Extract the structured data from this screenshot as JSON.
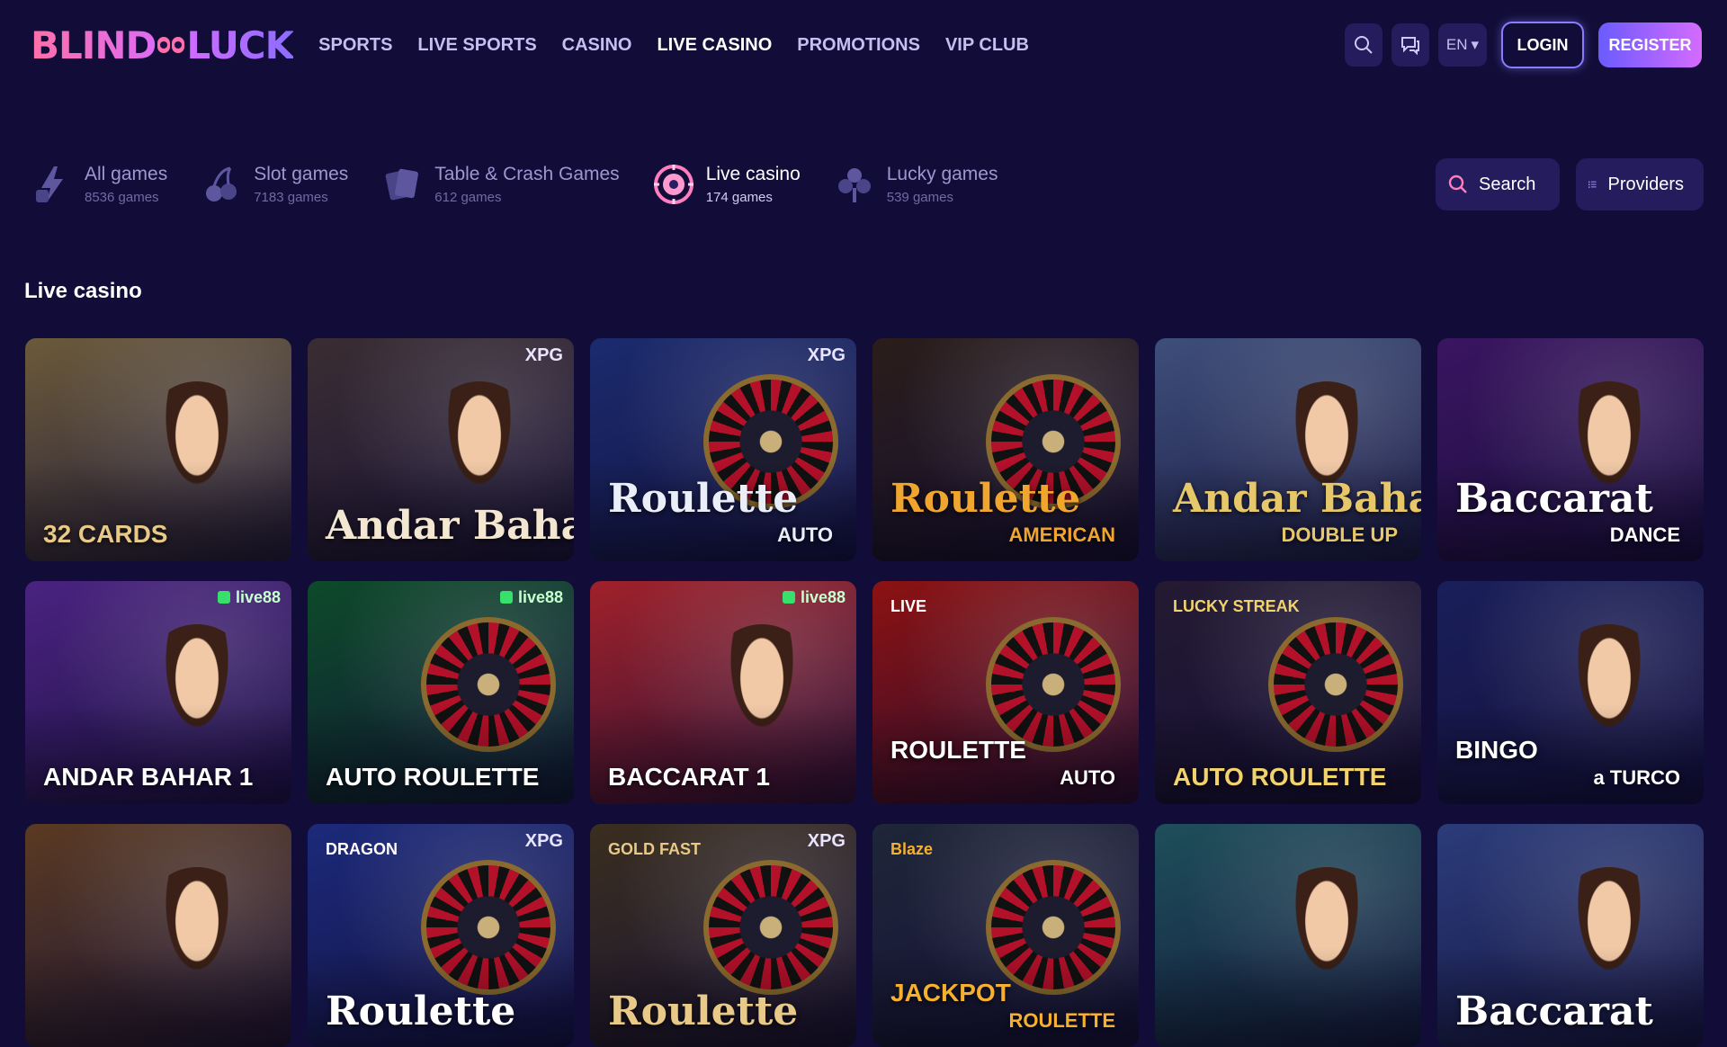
{
  "header": {
    "logo_text_left": "BLIND",
    "logo_text_right": "LUCK",
    "nav": [
      {
        "label": "SPORTS",
        "active": false
      },
      {
        "label": "LIVE SPORTS",
        "active": false
      },
      {
        "label": "CASINO",
        "active": false
      },
      {
        "label": "LIVE CASINO",
        "active": true
      },
      {
        "label": "PROMOTIONS",
        "active": false
      },
      {
        "label": "VIP CLUB",
        "active": false
      }
    ],
    "search_icon": "search-icon",
    "chat_icon": "chat-icon",
    "language": "EN",
    "login_label": "LOGIN",
    "register_label": "REGISTER"
  },
  "categories": [
    {
      "title": "All games",
      "count": "8536 games",
      "icon": "lightning-icon",
      "active": false
    },
    {
      "title": "Slot games",
      "count": "7183 games",
      "icon": "cherries-icon",
      "active": false
    },
    {
      "title": "Table & Crash Games",
      "count": "612 games",
      "icon": "cards-icon",
      "active": false
    },
    {
      "title": "Live casino",
      "count": "174 games",
      "icon": "roulette-chip-icon",
      "active": true
    },
    {
      "title": "Lucky games",
      "count": "539 games",
      "icon": "clover-icon",
      "active": false
    }
  ],
  "tools": {
    "search_label": "Search",
    "providers_label": "Providers"
  },
  "section_title": "Live casino",
  "games": [
    {
      "title": "32 CARDS",
      "brand": "",
      "bg": "#6b5a3a",
      "accent": "#e8c987"
    },
    {
      "title": "Andar Bahar",
      "brand": "XPG",
      "bg": "#3a2d32",
      "accent": "#f3e7d2"
    },
    {
      "title": "Roulette",
      "subtitle": "AUTO",
      "brand": "XPG",
      "bg": "#1b2b6e",
      "accent": "#e9eef9"
    },
    {
      "title": "Roulette",
      "subtitle": "AMERICAN",
      "brand": "",
      "bg": "#2a1d1a",
      "accent": "#f0a52e"
    },
    {
      "title": "Andar Bahar",
      "subtitle": "DOUBLE UP",
      "brand": "",
      "bg": "#3e4f7a",
      "accent": "#e6c76a"
    },
    {
      "title": "Baccarat",
      "subtitle": "DANCE",
      "brand": "",
      "bg": "#3a1560",
      "accent": "#ffffff"
    },
    {
      "title": "ANDAR BAHAR 1",
      "brand": "live88",
      "bg": "#4a2380",
      "accent": "#ffffff"
    },
    {
      "title": "AUTO ROULETTE",
      "brand": "live88",
      "bg": "#0d4a2a",
      "accent": "#ffffff"
    },
    {
      "title": "BACCARAT 1",
      "brand": "live88",
      "bg": "#a0212a",
      "accent": "#ffffff"
    },
    {
      "title": "ROULETTE",
      "pretitle": "LIVE",
      "subtitle": "AUTO",
      "brand": "",
      "bg": "#8c1212",
      "accent": "#ffffff"
    },
    {
      "title": "AUTO ROULETTE",
      "pretitle": "LUCKY STREAK",
      "brand": "",
      "bg": "#241a32",
      "accent": "#f2d36b"
    },
    {
      "title": "BINGO",
      "subtitle": "a TURCO",
      "brand": "",
      "bg": "#1a1f5a",
      "accent": "#ffffff"
    },
    {
      "title": "",
      "brand": "",
      "bg": "#5a3a22",
      "accent": "#ffffff"
    },
    {
      "title": "Roulette",
      "pretitle": "DRAGON",
      "brand": "XPG",
      "bg": "#1c2a7a",
      "accent": "#ffffff"
    },
    {
      "title": "Roulette",
      "pretitle": "GOLD FAST",
      "brand": "XPG",
      "bg": "#3a2e1f",
      "accent": "#e8c987"
    },
    {
      "title": "JACKPOT",
      "pretitle": "Blaze",
      "subtitle": "ROULETTE",
      "brand": "",
      "bg": "#1f2638",
      "accent": "#f5b030"
    },
    {
      "title": "",
      "brand": "",
      "bg": "#1e4f5a",
      "accent": "#ffffff"
    },
    {
      "title": "Baccarat",
      "brand": "",
      "bg": "#2b3c7a",
      "accent": "#ffffff"
    }
  ]
}
